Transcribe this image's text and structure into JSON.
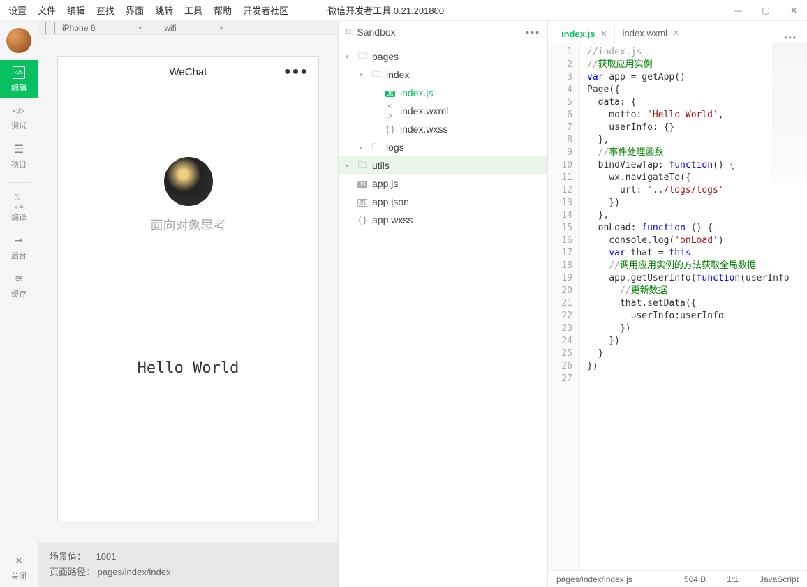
{
  "menubar": [
    "设置",
    "文件",
    "编辑",
    "查找",
    "界面",
    "跳转",
    "工具",
    "帮助",
    "开发者社区"
  ],
  "app_title": "微信开发者工具 0.21.201800",
  "sidebar": {
    "items": [
      {
        "label": "编辑"
      },
      {
        "label": "调试"
      },
      {
        "label": "项目"
      },
      {
        "label": "编译"
      },
      {
        "label": "后台"
      },
      {
        "label": "缓存"
      },
      {
        "label": "关闭"
      }
    ]
  },
  "simulator": {
    "device": "iPhone 6",
    "network": "wifi",
    "app_name": "WeChat",
    "user_name": "面向对象思考",
    "motto": "Hello World",
    "scene_label": "场景值：",
    "scene_value": "1001",
    "path_label": "页面路径：",
    "path_value": "pages/index/index"
  },
  "tree": {
    "title": "Sandbox",
    "items": [
      {
        "label": "pages",
        "type": "folder",
        "depth": 0,
        "expanded": true
      },
      {
        "label": "index",
        "type": "folder",
        "depth": 1,
        "expanded": true
      },
      {
        "label": "index.js",
        "type": "js",
        "depth": 2,
        "active": true
      },
      {
        "label": "index.wxml",
        "type": "wxml",
        "depth": 2
      },
      {
        "label": "index.wxss",
        "type": "wxss",
        "depth": 2
      },
      {
        "label": "logs",
        "type": "folder",
        "depth": 1,
        "expanded": false
      },
      {
        "label": "utils",
        "type": "folder",
        "depth": 0,
        "expanded": false,
        "selected": true
      },
      {
        "label": "app.js",
        "type": "js-gray",
        "depth": 0
      },
      {
        "label": "app.json",
        "type": "json",
        "depth": 0
      },
      {
        "label": "app.wxss",
        "type": "wxss",
        "depth": 0
      }
    ]
  },
  "editor": {
    "tabs": [
      {
        "label": "index.js",
        "active": true
      },
      {
        "label": "index.wxml",
        "active": false
      }
    ],
    "code": [
      {
        "n": 1,
        "html": "<span class='c-comment'>//index.js</span>"
      },
      {
        "n": 2,
        "html": "<span class='c-comment'>//</span><span class='c-green'>获取应用实例</span>"
      },
      {
        "n": 3,
        "html": "<span class='c-kw'>var</span> app = getApp()"
      },
      {
        "n": 4,
        "html": "Page({"
      },
      {
        "n": 5,
        "html": "  data: {"
      },
      {
        "n": 6,
        "html": "    motto: <span class='c-str'>'Hello World'</span>,"
      },
      {
        "n": 7,
        "html": "    userInfo: {}"
      },
      {
        "n": 8,
        "html": "  },"
      },
      {
        "n": 9,
        "html": "  <span class='c-comment'>//</span><span class='c-green'>事件处理函数</span>"
      },
      {
        "n": 10,
        "html": "  bindViewTap: <span class='c-kw'>function</span>() {"
      },
      {
        "n": 11,
        "html": "    wx.navigateTo({"
      },
      {
        "n": 12,
        "html": "      url: <span class='c-str'>'../logs/logs'</span>"
      },
      {
        "n": 13,
        "html": "    })"
      },
      {
        "n": 14,
        "html": "  },"
      },
      {
        "n": 15,
        "html": "  onLoad: <span class='c-kw'>function</span> () {"
      },
      {
        "n": 16,
        "html": "    console.log(<span class='c-str'>'onLoad'</span>)"
      },
      {
        "n": 17,
        "html": "    <span class='c-kw'>var</span> that = <span class='c-kw'>this</span>"
      },
      {
        "n": 18,
        "html": "    <span class='c-comment'>//</span><span class='c-green'>调用应用实例的方法获取全局数据</span>"
      },
      {
        "n": 19,
        "html": "    app.getUserInfo(<span class='c-kw'>function</span>(userInfo"
      },
      {
        "n": 20,
        "html": "      <span class='c-comment'>//</span><span class='c-green'>更新数据</span>"
      },
      {
        "n": 21,
        "html": "      that.setData({"
      },
      {
        "n": 22,
        "html": "        userInfo:userInfo"
      },
      {
        "n": 23,
        "html": "      })"
      },
      {
        "n": 24,
        "html": "    })"
      },
      {
        "n": 25,
        "html": "  }"
      },
      {
        "n": 26,
        "html": "})"
      },
      {
        "n": 27,
        "html": ""
      }
    ],
    "status": {
      "path": "pages/index/index.js",
      "size": "504 B",
      "pos": "1:1",
      "lang": "JavaScript"
    }
  }
}
